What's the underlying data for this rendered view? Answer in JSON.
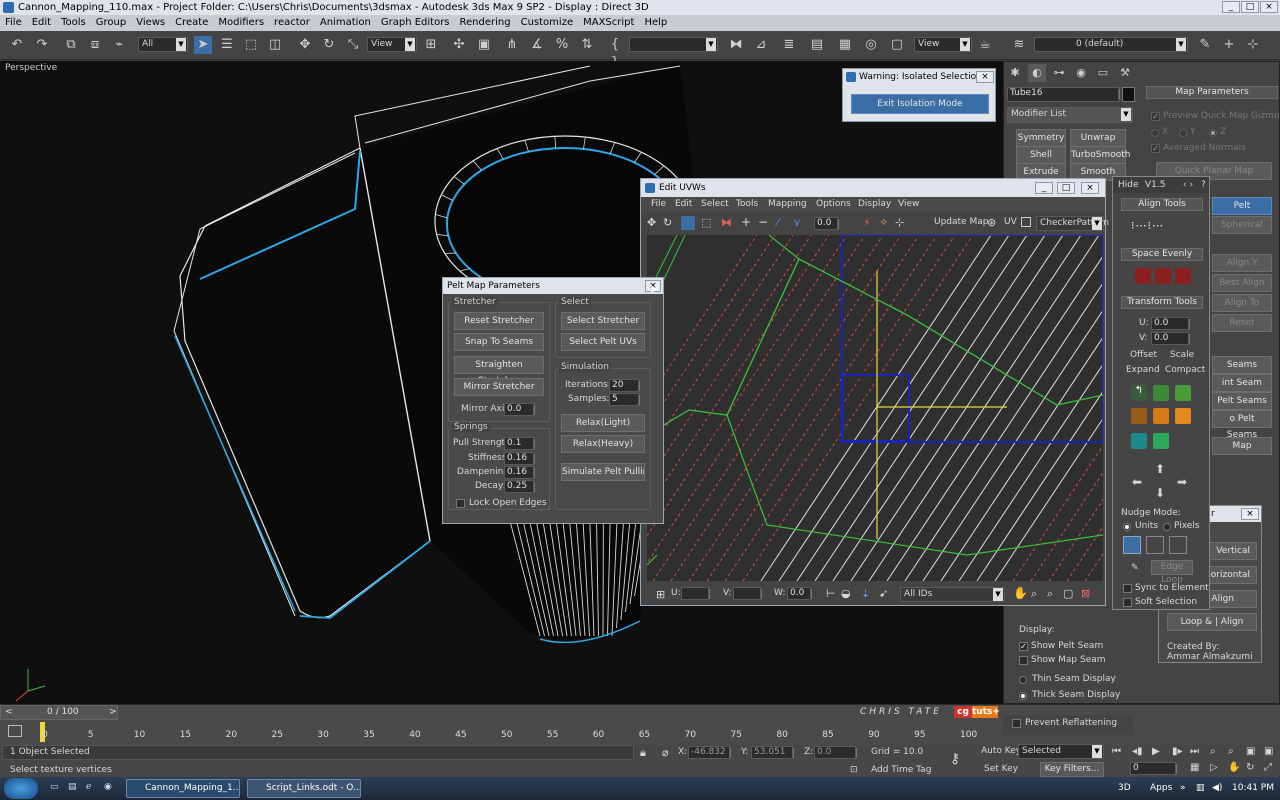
{
  "app_title": "Cannon_Mapping_110.max    - Project Folder: C:\\Users\\Chris\\Documents\\3dsmax    - Autodesk 3ds Max 9 SP2    - Display : Direct 3D",
  "menu": [
    "File",
    "Edit",
    "Tools",
    "Group",
    "Views",
    "Create",
    "Modifiers",
    "reactor",
    "Animation",
    "Graph Editors",
    "Rendering",
    "Customize",
    "MAXScript",
    "Help"
  ],
  "toolbar": {
    "selection_filter": "All",
    "ref_coord": "View",
    "named_sel": "",
    "layer": "0 (default)",
    "ref_coord2": "View"
  },
  "viewport": {
    "label": "Perspective"
  },
  "isolation": {
    "title": "Warning: Isolated Selection",
    "button": "Exit Isolation Mode"
  },
  "command_panel": {
    "object_name": "Tube16",
    "modifier_list": "Modifier List",
    "modifiers": [
      [
        "Symmetry",
        "Unwrap UVW"
      ],
      [
        "Shell",
        "TurboSmooth"
      ],
      [
        "Extrude",
        "Smooth"
      ]
    ],
    "map_params_title": "Map Parameters",
    "preview_label": "Preview Quick Map Gizmo",
    "axes": [
      "X",
      "Y",
      "Z"
    ],
    "averaged_normals": "Averaged Normals",
    "quick_planar": "Quick Planar Map",
    "right_col": [
      "Pelt",
      "Spherical",
      "Align Y",
      "Best Align",
      "Align To View",
      "Reset",
      "Seams",
      "int Seam",
      "Pelt Seams",
      "o Pelt Seams",
      "Map"
    ],
    "display_title": "Display:",
    "display_options": [
      "Show Pelt Seam",
      "Show Map Seam",
      "Thin Seam Display",
      "Thick Seam Display"
    ],
    "prevent": "Prevent Reflattening"
  },
  "edit_uvws": {
    "title": "Edit UVWs",
    "menu": [
      "File",
      "Edit",
      "Select",
      "Tools",
      "Mapping",
      "Options",
      "Display",
      "View"
    ],
    "spinner": "0.0",
    "update_map": "Update Map",
    "uv": "UV",
    "checker": "CheckerPattern",
    "bottom": {
      "u_label": "U:",
      "v_label": "V:",
      "w_label": "W:",
      "w_val": "0.0",
      "all_ids": "All IDs"
    }
  },
  "side_tools": {
    "hide": "Hide",
    "version": "V1.5",
    "question": "?",
    "align_tools": "Align Tools",
    "space_evenly": "Space Evenly",
    "transform_tools": "Transform Tools",
    "u_label": "U:",
    "u_val": "0.0",
    "v_label": "V:",
    "v_val": "0.0",
    "offset": "Offset",
    "scale": "Scale",
    "expand": "Expand",
    "compact": "Compact",
    "nudge_mode": "Nudge Mode:",
    "units": "Units",
    "pixels": "Pixels",
    "edge_loop": "Edge Loop",
    "sync": "Sync to Element",
    "soft": "Soft Selection"
  },
  "loop_panel": {
    "letter": "r",
    "vertical": "Vertical",
    "horizontal": "Horizontal",
    "align": "- Align",
    "loop_align": "Loop & | Align",
    "created_by": "Created By:",
    "author": "Ammar Almakzumi"
  },
  "pelt": {
    "title": "Pelt Map Parameters",
    "stretcher_title": "Stretcher",
    "select_title": "Select",
    "stretcher_buttons": [
      "Reset Stretcher",
      "Snap To Seams",
      "Straighten Stretcher",
      "Mirror Stretcher"
    ],
    "select_buttons": [
      "Select Stretcher",
      "Select Pelt UVs"
    ],
    "mirror_axis_label": "Mirror Axis:",
    "mirror_axis": "0.0",
    "simulation_title": "Simulation",
    "iterations_label": "Iterations:",
    "iterations": "20",
    "samples_label": "Samples:",
    "samples": "5",
    "relax_light": "Relax(Light)",
    "relax_heavy": "Relax(Heavy)",
    "simulate": "Simulate Pelt Pulling",
    "springs_title": "Springs",
    "springs": [
      {
        "label": "Pull Strength:",
        "value": "0.1"
      },
      {
        "label": "Stiffness:",
        "value": "0.16"
      },
      {
        "label": "Dampening:",
        "value": "0.16"
      },
      {
        "label": "Decay:",
        "value": "0.25"
      }
    ],
    "lock": "Lock Open Edges"
  },
  "timeline": {
    "frame": "0 / 100",
    "ticks": [
      "0",
      "5",
      "10",
      "15",
      "20",
      "25",
      "30",
      "35",
      "40",
      "45",
      "50",
      "55",
      "60",
      "65",
      "70",
      "75",
      "80",
      "85",
      "90",
      "95",
      "100"
    ],
    "watermark": "CHRIS TATE",
    "cg": "cg",
    "tuts": "tuts+"
  },
  "status": {
    "selected": "1 Object Selected",
    "prompt": "Select texture vertices",
    "x_label": "X:",
    "x": "-46.832",
    "y_label": "Y:",
    "y": "53.051",
    "z_label": "Z:",
    "z": "0.0",
    "grid": "Grid = 10.0",
    "add_time_tag": "Add Time Tag",
    "auto_key": "Auto Key",
    "selected_dd": "Selected",
    "set_key": "Set Key",
    "key_filters": "Key Filters...",
    "frame_val": "0"
  },
  "taskbar": {
    "items": [
      "Cannon_Mapping_1...",
      "Script_Links.odt - O..."
    ],
    "tray": [
      "3D",
      "Apps"
    ],
    "time": "10:41 PM"
  },
  "colors": {
    "seam_blue": "#2ea7e8",
    "uv_green": "#39c23a",
    "uv_red": "#e04848",
    "uv_blue": "#1a24b8",
    "gizmo_yellow": "#e8d83a",
    "accent": "#3a6ea5"
  }
}
